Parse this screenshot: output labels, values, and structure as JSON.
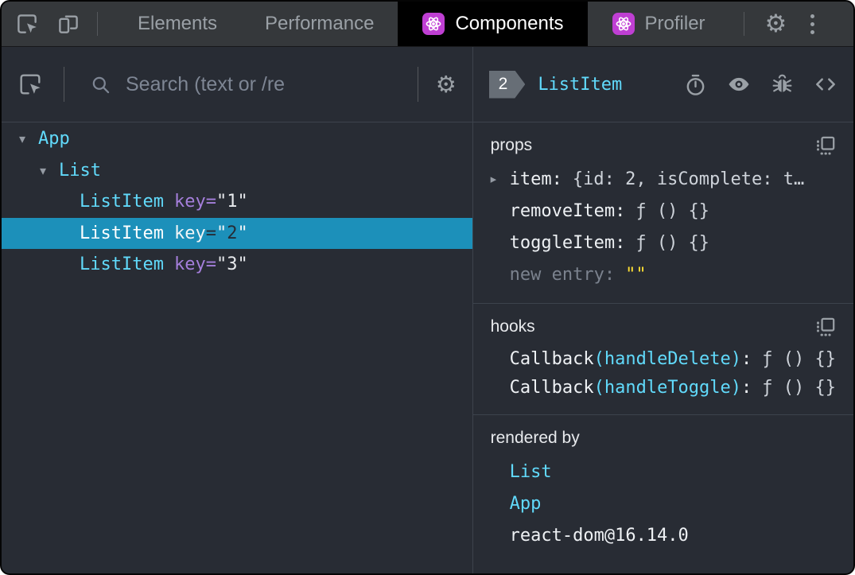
{
  "topbar": {
    "tabs": [
      {
        "label": "Elements"
      },
      {
        "label": "Performance"
      },
      {
        "label": "Components"
      },
      {
        "label": "Profiler"
      }
    ]
  },
  "icons": {
    "gear": "⚙",
    "caret_down": "▾",
    "caret_right": "▸"
  },
  "punct": {
    "colon": ":",
    "eq": "=",
    "quote": "\""
  },
  "colors": {
    "component_cyan": "#61dafb",
    "attribute_purple": "#a57fdc",
    "selection_blue": "#1c90ba",
    "react_purple": "#bf3fd3",
    "string_yellow": "#ffdf33",
    "panel_background": "#282c34",
    "topbar_background": "#35383b"
  },
  "left": {
    "search_placeholder": "Search (text or /re",
    "tree": [
      {
        "name": "App"
      },
      {
        "name": "List"
      },
      {
        "name": "ListItem",
        "attr": {
          "name": "key",
          "value": "1"
        }
      },
      {
        "name": "ListItem",
        "attr": {
          "name": "key",
          "value": "2"
        }
      },
      {
        "name": "ListItem",
        "attr": {
          "name": "key",
          "value": "3"
        }
      }
    ]
  },
  "right": {
    "badge": "2",
    "component": "ListItem",
    "props": {
      "title": "props",
      "rows": [
        {
          "key": "item",
          "value": "{id: 2, isComplete: t…"
        },
        {
          "key": "removeItem",
          "value": "ƒ () {}"
        },
        {
          "key": "toggleItem",
          "value": "ƒ () {}"
        },
        {
          "key": "new entry",
          "value": "\"\""
        }
      ]
    },
    "hooks": {
      "title": "hooks",
      "rows": [
        {
          "key": "Callback",
          "paren": "(handleDelete)",
          "value": "ƒ () {}"
        },
        {
          "key": "Callback",
          "paren": "(handleToggle)",
          "value": "ƒ () {}"
        }
      ]
    },
    "rendered_by": {
      "title": "rendered by",
      "items": [
        "List",
        "App",
        "react-dom@16.14.0"
      ]
    }
  }
}
